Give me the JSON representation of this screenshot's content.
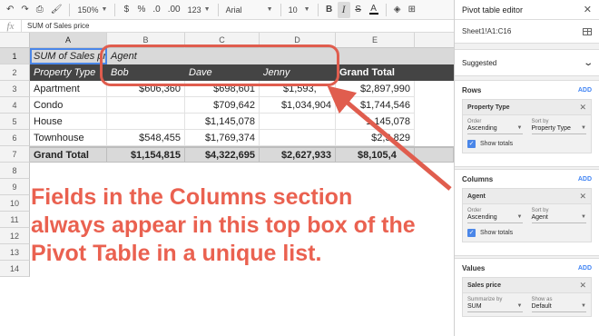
{
  "toolbar": {
    "zoom": "150%",
    "currency": "$",
    "percent": "%",
    "decrease_decimal": ".0",
    "increase_decimal": ".00",
    "more_formats": "123",
    "font": "Arial",
    "font_size": "10",
    "bold": "B",
    "italic": "I",
    "text_color": "A"
  },
  "formula_bar": {
    "fx": "fx",
    "value": "SUM of Sales price"
  },
  "grid": {
    "columns": [
      "A",
      "B",
      "C",
      "D",
      "E"
    ],
    "rows": [
      "1",
      "2",
      "3",
      "4",
      "5",
      "6",
      "7",
      "8",
      "9",
      "10",
      "11",
      "12",
      "13",
      "14"
    ],
    "r1": {
      "a": "SUM of Sales pr",
      "b": "Agent"
    },
    "r2": {
      "a": "Property Type",
      "b": "Bob",
      "c": "Dave",
      "d": "Jenny",
      "e": "Grand Total"
    },
    "data_rows": [
      {
        "a": "Apartment",
        "b": "$606,360",
        "c": "$698,601",
        "d": "$1,593,",
        "e": "$2,897,990"
      },
      {
        "a": "Condo",
        "b": "",
        "c": "$709,642",
        "d": "$1,034,904",
        "e": "$1,744,546"
      },
      {
        "a": "House",
        "b": "",
        "c": "$1,145,078",
        "d": "",
        "e": "1,145,078"
      },
      {
        "a": "Townhouse",
        "b": "$548,455",
        "c": "$1,769,374",
        "d": "",
        "e": "$2,3 829"
      }
    ],
    "grand_total": {
      "a": "Grand Total",
      "b": "$1,154,815",
      "c": "$4,322,695",
      "d": "$2,627,933",
      "e": "$8,105,4"
    }
  },
  "callout": "Fields in the Columns section always appear in this top box of the Pivot Table in a unique list.",
  "annotation_color": "#e05d4e",
  "panel": {
    "title": "Pivot table editor",
    "range": "Sheet1!A1:C16",
    "suggested": "Suggested",
    "rows": {
      "label": "Rows",
      "add": "ADD",
      "field": "Property Type",
      "order_label": "Order",
      "order": "Ascending",
      "sortby_label": "Sort by",
      "sortby": "Property Type",
      "show_totals": "Show totals"
    },
    "columns": {
      "label": "Columns",
      "add": "ADD",
      "field": "Agent",
      "order_label": "Order",
      "order": "Ascending",
      "sortby_label": "Sort by",
      "sortby": "Agent",
      "show_totals": "Show totals"
    },
    "values": {
      "label": "Values",
      "add": "ADD",
      "field": "Sales price",
      "summarize_label": "Summarize by",
      "summarize": "SUM",
      "showas_label": "Show as",
      "showas": "Default"
    }
  }
}
